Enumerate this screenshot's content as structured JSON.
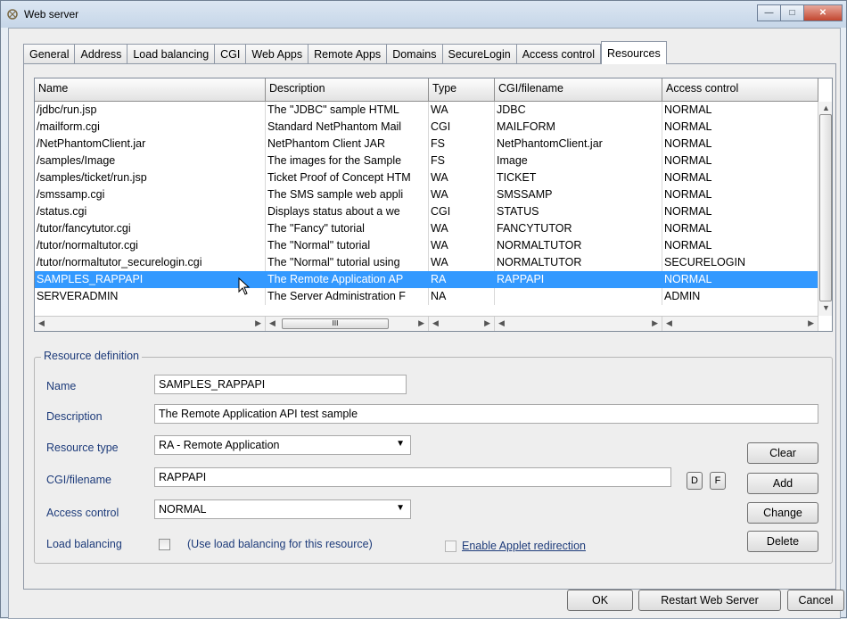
{
  "window": {
    "title": "Web server"
  },
  "tabs": [
    "General",
    "Address",
    "Load balancing",
    "CGI",
    "Web Apps",
    "Remote Apps",
    "Domains",
    "SecureLogin",
    "Access control",
    "Resources"
  ],
  "active_tab": "Resources",
  "table": {
    "columns": [
      "Name",
      "Description",
      "Type",
      "CGI/filename",
      "Access control"
    ],
    "rows": [
      [
        "/jdbc/run.jsp",
        "The \"JDBC\" sample HTML ",
        "WA",
        "JDBC",
        "NORMAL"
      ],
      [
        "/mailform.cgi",
        "Standard NetPhantom Mail",
        "CGI",
        "MAILFORM",
        "NORMAL"
      ],
      [
        "/NetPhantomClient.jar",
        "NetPhantom Client JAR",
        "FS",
        "NetPhantomClient.jar",
        "NORMAL"
      ],
      [
        "/samples/Image",
        "The images for the Sample",
        "FS",
        "Image",
        "NORMAL"
      ],
      [
        "/samples/ticket/run.jsp",
        "Ticket Proof of Concept HTM",
        "WA",
        "TICKET",
        "NORMAL"
      ],
      [
        "/smssamp.cgi",
        "The SMS sample web appli",
        "WA",
        "SMSSAMP",
        "NORMAL"
      ],
      [
        "/status.cgi",
        "Displays status about a we",
        "CGI",
        "STATUS",
        "NORMAL"
      ],
      [
        "/tutor/fancytutor.cgi",
        "The \"Fancy\" tutorial",
        "WA",
        "FANCYTUTOR",
        "NORMAL"
      ],
      [
        "/tutor/normaltutor.cgi",
        "The \"Normal\" tutorial",
        "WA",
        "NORMALTUTOR",
        "NORMAL"
      ],
      [
        "/tutor/normaltutor_securelogin.cgi",
        "The \"Normal\" tutorial using",
        "WA",
        "NORMALTUTOR",
        "SECURELOGIN"
      ],
      [
        "SAMPLES_RAPPAPI",
        "The Remote Application AP",
        "RA",
        "RAPPAPI",
        "NORMAL"
      ],
      [
        "SERVERADMIN",
        "The Server Administration F",
        "NA",
        "",
        "ADMIN"
      ]
    ],
    "selected_row": 10,
    "scroll_thumb_glyph": "III"
  },
  "definition": {
    "group_title": "Resource definition",
    "name_label": "Name",
    "name_value": "SAMPLES_RAPPAPI",
    "description_label": "Description",
    "description_value": "The Remote Application API test sample",
    "type_label": "Resource type",
    "type_value": "RA - Remote Application",
    "cgi_label": "CGI/filename",
    "cgi_value": "RAPPAPI",
    "access_label": "Access control",
    "access_value": "NORMAL",
    "lb_label": "Load balancing",
    "lb_note": "(Use load balancing for this resource)",
    "applet_label": "Enable Applet redirection",
    "d_button": "D",
    "f_button": "F"
  },
  "side_buttons": {
    "clear": "Clear",
    "add": "Add",
    "change": "Change",
    "delete": "Delete"
  },
  "footer_buttons": {
    "ok": "OK",
    "restart": "Restart Web Server",
    "cancel": "Cancel"
  }
}
